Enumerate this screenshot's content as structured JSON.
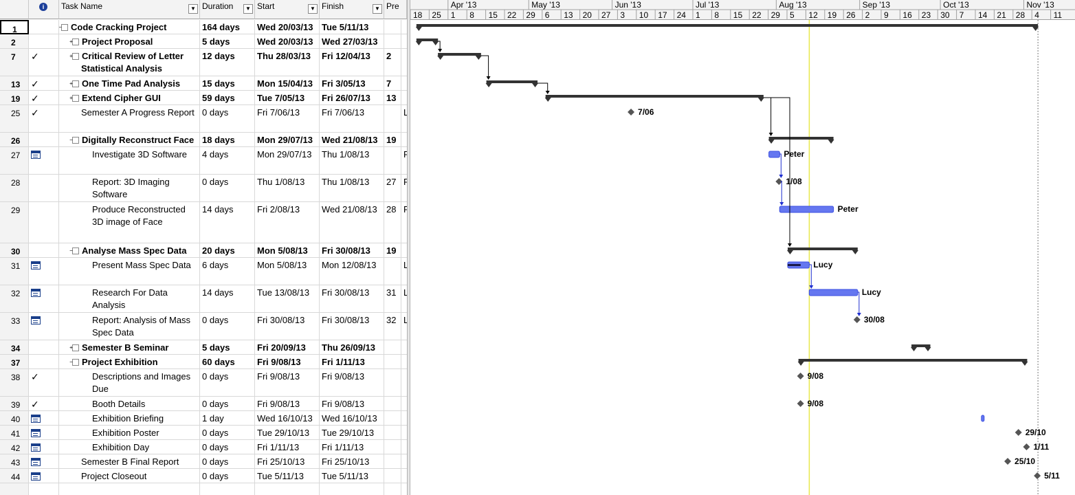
{
  "columns": {
    "info_icon": "info-icon",
    "task_name": "Task Name",
    "duration": "Duration",
    "start": "Start",
    "finish": "Finish",
    "predecessors": "Pre"
  },
  "timescale": {
    "months": [
      "Apr '13",
      "May '13",
      "Jun '13",
      "Jul '13",
      "Aug '13",
      "Sep '13",
      "Oct '13",
      "Nov '13"
    ],
    "days": [
      "18",
      "25",
      "1",
      "8",
      "15",
      "22",
      "29",
      "6",
      "13",
      "20",
      "27",
      "3",
      "10",
      "17",
      "24",
      "1",
      "8",
      "15",
      "22",
      "29",
      "5",
      "12",
      "19",
      "26",
      "2",
      "9",
      "16",
      "23",
      "30",
      "7",
      "14",
      "21",
      "28",
      "4",
      "11"
    ]
  },
  "rows": [
    {
      "id": "1",
      "icon": "",
      "name": "Code Cracking Project",
      "duration": "164 days",
      "start": "Wed 20/03/13",
      "finish": "Tue 5/11/13",
      "pred": "",
      "res": "",
      "bold": true,
      "indent": 0,
      "toggle": "-"
    },
    {
      "id": "2",
      "icon": "",
      "name": "Project Proposal",
      "duration": "5 days",
      "start": "Wed 20/03/13",
      "finish": "Wed 27/03/13",
      "pred": "",
      "res": "",
      "bold": true,
      "indent": 1,
      "toggle": "+"
    },
    {
      "id": "7",
      "icon": "check-icon",
      "name": "Critical Review of Letter Statistical Analysis",
      "duration": "12 days",
      "start": "Thu 28/03/13",
      "finish": "Fri 12/04/13",
      "pred": "2",
      "res": "",
      "bold": true,
      "indent": 1,
      "toggle": "+"
    },
    {
      "id": "13",
      "icon": "check-icon",
      "name": "One Time Pad Analysis",
      "duration": "15 days",
      "start": "Mon 15/04/13",
      "finish": "Fri 3/05/13",
      "pred": "7",
      "res": "",
      "bold": true,
      "indent": 1,
      "toggle": "+"
    },
    {
      "id": "19",
      "icon": "check-icon",
      "name": "Extend Cipher GUI",
      "duration": "59 days",
      "start": "Tue 7/05/13",
      "finish": "Fri 26/07/13",
      "pred": "13",
      "res": "",
      "bold": true,
      "indent": 1,
      "toggle": "+"
    },
    {
      "id": "25",
      "icon": "check-icon",
      "name": "Semester A Progress Report",
      "duration": "0 days",
      "start": "Fri 7/06/13",
      "finish": "Fri 7/06/13",
      "pred": "",
      "res": "L",
      "bold": false,
      "indent": 1,
      "toggle": ""
    },
    {
      "id": "26",
      "icon": "",
      "name": "Digitally Reconstruct Face",
      "duration": "18 days",
      "start": "Mon 29/07/13",
      "finish": "Wed 21/08/13",
      "pred": "19",
      "res": "",
      "bold": true,
      "indent": 1,
      "toggle": "-"
    },
    {
      "id": "27",
      "icon": "calendar-icon",
      "name": "Investigate 3D Software",
      "duration": "4 days",
      "start": "Mon 29/07/13",
      "finish": "Thu 1/08/13",
      "pred": "",
      "res": "F",
      "bold": false,
      "indent": 2,
      "toggle": ""
    },
    {
      "id": "28",
      "icon": "",
      "name": "Report: 3D Imaging Software",
      "duration": "0 days",
      "start": "Thu 1/08/13",
      "finish": "Thu 1/08/13",
      "pred": "27",
      "res": "F",
      "bold": false,
      "indent": 2,
      "toggle": ""
    },
    {
      "id": "29",
      "icon": "",
      "name": "Produce Reconstructed 3D image of Face",
      "duration": "14 days",
      "start": "Fri 2/08/13",
      "finish": "Wed 21/08/13",
      "pred": "28",
      "res": "F",
      "bold": false,
      "indent": 2,
      "toggle": ""
    },
    {
      "id": "30",
      "icon": "",
      "name": "Analyse Mass Spec Data",
      "duration": "20 days",
      "start": "Mon 5/08/13",
      "finish": "Fri 30/08/13",
      "pred": "19",
      "res": "",
      "bold": true,
      "indent": 1,
      "toggle": "-"
    },
    {
      "id": "31",
      "icon": "calendar-icon",
      "name": "Present Mass Spec Data",
      "duration": "6 days",
      "start": "Mon 5/08/13",
      "finish": "Mon 12/08/13",
      "pred": "",
      "res": "L",
      "bold": false,
      "indent": 2,
      "toggle": ""
    },
    {
      "id": "32",
      "icon": "calendar-icon",
      "name": "Research For Data Analysis",
      "duration": "14 days",
      "start": "Tue 13/08/13",
      "finish": "Fri 30/08/13",
      "pred": "31",
      "res": "L",
      "bold": false,
      "indent": 2,
      "toggle": ""
    },
    {
      "id": "33",
      "icon": "calendar-icon",
      "name": "Report: Analysis of Mass Spec Data",
      "duration": "0 days",
      "start": "Fri 30/08/13",
      "finish": "Fri 30/08/13",
      "pred": "32",
      "res": "L",
      "bold": false,
      "indent": 2,
      "toggle": ""
    },
    {
      "id": "34",
      "icon": "",
      "name": "Semester B Seminar",
      "duration": "5 days",
      "start": "Fri 20/09/13",
      "finish": "Thu 26/09/13",
      "pred": "",
      "res": "",
      "bold": true,
      "indent": 1,
      "toggle": "+"
    },
    {
      "id": "37",
      "icon": "",
      "name": "Project Exhibition",
      "duration": "60 days",
      "start": "Fri 9/08/13",
      "finish": "Fri 1/11/13",
      "pred": "",
      "res": "",
      "bold": true,
      "indent": 1,
      "toggle": "-"
    },
    {
      "id": "38",
      "icon": "check-icon",
      "name": "Descriptions and Images Due",
      "duration": "0 days",
      "start": "Fri 9/08/13",
      "finish": "Fri 9/08/13",
      "pred": "",
      "res": "",
      "bold": false,
      "indent": 2,
      "toggle": ""
    },
    {
      "id": "39",
      "icon": "check-icon",
      "name": "Booth Details",
      "duration": "0 days",
      "start": "Fri 9/08/13",
      "finish": "Fri 9/08/13",
      "pred": "",
      "res": "",
      "bold": false,
      "indent": 2,
      "toggle": ""
    },
    {
      "id": "40",
      "icon": "calendar-icon",
      "name": "Exhibition Briefing",
      "duration": "1 day",
      "start": "Wed 16/10/13",
      "finish": "Wed 16/10/13",
      "pred": "",
      "res": "",
      "bold": false,
      "indent": 2,
      "toggle": ""
    },
    {
      "id": "41",
      "icon": "calendar-icon",
      "name": "Exhibition Poster",
      "duration": "0 days",
      "start": "Tue 29/10/13",
      "finish": "Tue 29/10/13",
      "pred": "",
      "res": "",
      "bold": false,
      "indent": 2,
      "toggle": ""
    },
    {
      "id": "42",
      "icon": "calendar-icon",
      "name": "Exhibition Day",
      "duration": "0 days",
      "start": "Fri 1/11/13",
      "finish": "Fri 1/11/13",
      "pred": "",
      "res": "",
      "bold": false,
      "indent": 2,
      "toggle": ""
    },
    {
      "id": "43",
      "icon": "calendar-icon",
      "name": "Semester B Final Report",
      "duration": "0 days",
      "start": "Fri 25/10/13",
      "finish": "Fri 25/10/13",
      "pred": "",
      "res": "",
      "bold": false,
      "indent": 1,
      "toggle": ""
    },
    {
      "id": "44",
      "icon": "calendar-icon",
      "name": "Project Closeout",
      "duration": "0 days",
      "start": "Tue 5/11/13",
      "finish": "Tue 5/11/13",
      "pred": "",
      "res": "",
      "bold": false,
      "indent": 1,
      "toggle": ""
    }
  ],
  "gantt": {
    "today_line_date": "2013-08-12",
    "bars": [
      {
        "row": 0,
        "type": "summary",
        "start": "2013-03-20",
        "end": "2013-11-05"
      },
      {
        "row": 1,
        "type": "summary",
        "start": "2013-03-20",
        "end": "2013-03-27"
      },
      {
        "row": 2,
        "type": "summary",
        "start": "2013-03-28",
        "end": "2013-04-12"
      },
      {
        "row": 3,
        "type": "summary",
        "start": "2013-04-15",
        "end": "2013-05-03"
      },
      {
        "row": 4,
        "type": "summary",
        "start": "2013-05-07",
        "end": "2013-07-26"
      },
      {
        "row": 5,
        "type": "milestone",
        "start": "2013-06-07",
        "label": "7/06"
      },
      {
        "row": 6,
        "type": "summary",
        "start": "2013-07-29",
        "end": "2013-08-21"
      },
      {
        "row": 7,
        "type": "task",
        "start": "2013-07-29",
        "end": "2013-08-01",
        "label": "Peter"
      },
      {
        "row": 8,
        "type": "milestone",
        "start": "2013-08-01",
        "label": "1/08"
      },
      {
        "row": 9,
        "type": "task",
        "start": "2013-08-02",
        "end": "2013-08-21",
        "label": "Peter"
      },
      {
        "row": 10,
        "type": "summary",
        "start": "2013-08-05",
        "end": "2013-08-30"
      },
      {
        "row": 11,
        "type": "task",
        "start": "2013-08-05",
        "end": "2013-08-12",
        "label": "Lucy",
        "progress": 0.6
      },
      {
        "row": 12,
        "type": "task",
        "start": "2013-08-13",
        "end": "2013-08-30",
        "label": "Lucy"
      },
      {
        "row": 13,
        "type": "milestone",
        "start": "2013-08-30",
        "label": "30/08"
      },
      {
        "row": 14,
        "type": "summary",
        "start": "2013-09-20",
        "end": "2013-09-26"
      },
      {
        "row": 15,
        "type": "summary",
        "start": "2013-08-09",
        "end": "2013-11-01"
      },
      {
        "row": 16,
        "type": "milestone",
        "start": "2013-08-09",
        "label": "9/08"
      },
      {
        "row": 17,
        "type": "milestone",
        "start": "2013-08-09",
        "label": "9/08"
      },
      {
        "row": 18,
        "type": "task",
        "start": "2013-10-16",
        "end": "2013-10-16",
        "label": ""
      },
      {
        "row": 19,
        "type": "milestone",
        "start": "2013-10-29",
        "label": "29/10"
      },
      {
        "row": 20,
        "type": "milestone",
        "start": "2013-11-01",
        "label": "1/11"
      },
      {
        "row": 21,
        "type": "milestone",
        "start": "2013-10-25",
        "label": "25/10"
      },
      {
        "row": 22,
        "type": "milestone",
        "start": "2013-11-05",
        "label": "5/11"
      }
    ],
    "links": [
      {
        "from": 1,
        "to": 2
      },
      {
        "from": 2,
        "to": 3
      },
      {
        "from": 3,
        "to": 4
      },
      {
        "from": 4,
        "to": 6
      },
      {
        "from": 4,
        "to": 10
      },
      {
        "from": 7,
        "to": 8
      },
      {
        "from": 8,
        "to": 9
      },
      {
        "from": 11,
        "to": 12
      },
      {
        "from": 12,
        "to": 13
      }
    ],
    "colors": {
      "summary": "#333333",
      "task": "#3b4fe0",
      "task_fill": "#6577f0",
      "link_black": "#000000",
      "link_blue": "#1f2fd0",
      "today": "#e8e84a",
      "milestone": "#555555"
    }
  }
}
